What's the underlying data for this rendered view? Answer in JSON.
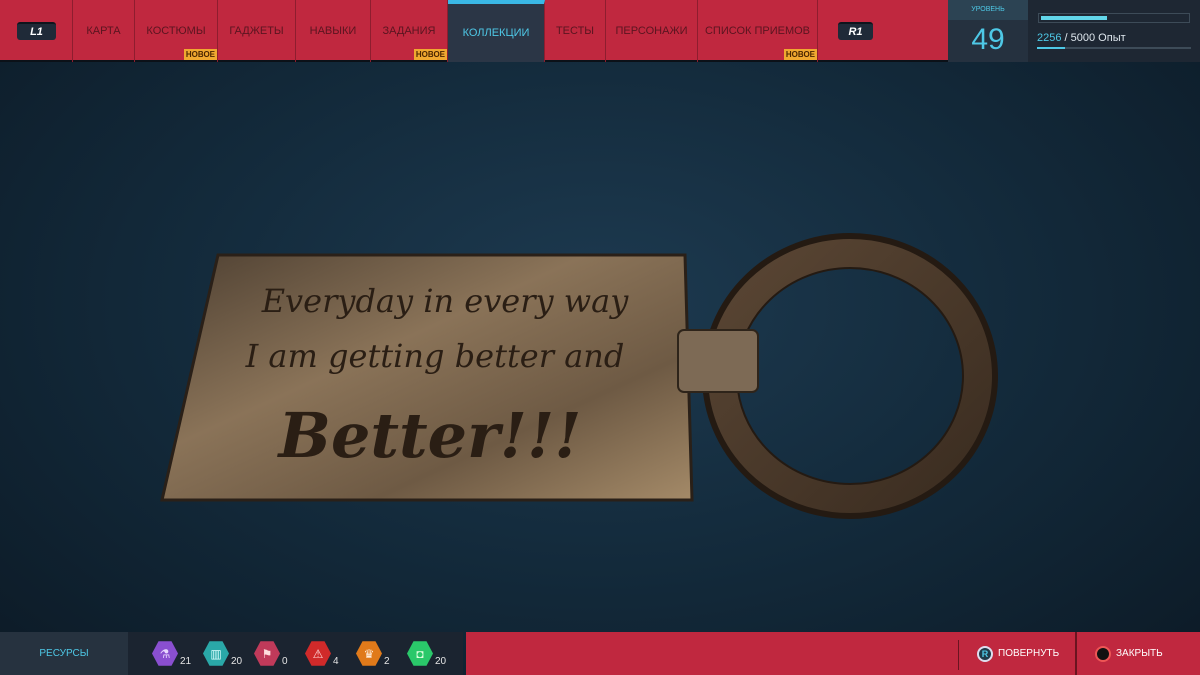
{
  "nav": {
    "left_button": "L1",
    "right_button": "R1",
    "tabs": [
      {
        "label": "КАРТА"
      },
      {
        "label": "КОСТЮМЫ",
        "badge": "НОВОЕ"
      },
      {
        "label": "ГАДЖЕТЫ"
      },
      {
        "label": "НАВЫКИ"
      },
      {
        "label": "ЗАДАНИЯ",
        "badge": "НОВОЕ"
      },
      {
        "label": "КОЛЛЕКЦИИ",
        "active": true
      },
      {
        "label": "ТЕСТЫ"
      },
      {
        "label": "ПЕРСОНАЖИ"
      },
      {
        "label": "СПИСОК ПРИЕМОВ",
        "badge": "НОВОЕ"
      }
    ]
  },
  "level": {
    "label": "УРОВЕНЬ",
    "value": "49"
  },
  "xp": {
    "current": "2256",
    "sep": " / ",
    "total": "5000 Опыт",
    "fraction": 0.45
  },
  "item": {
    "line1": "Everyday in every way",
    "line2": "I am getting better and",
    "line3": "Better!!!"
  },
  "resources": {
    "label": "РЕСУРСЫ",
    "items": [
      {
        "icon": "research-icon",
        "count": "21",
        "color": "#8a4fd0"
      },
      {
        "icon": "city-icon",
        "count": "20",
        "color": "#2aa8a8"
      },
      {
        "icon": "flag-icon",
        "count": "0",
        "color": "#c03a5a"
      },
      {
        "icon": "warning-icon",
        "count": "4",
        "color": "#d02a2a"
      },
      {
        "icon": "trophy-icon",
        "count": "2",
        "color": "#e07a1a"
      },
      {
        "icon": "backpack-icon",
        "count": "20",
        "color": "#2ac86a"
      }
    ]
  },
  "actions": {
    "rotate_key": "R",
    "rotate": "ПОВЕРНУТЬ",
    "close": "ЗАКРЫТЬ"
  }
}
